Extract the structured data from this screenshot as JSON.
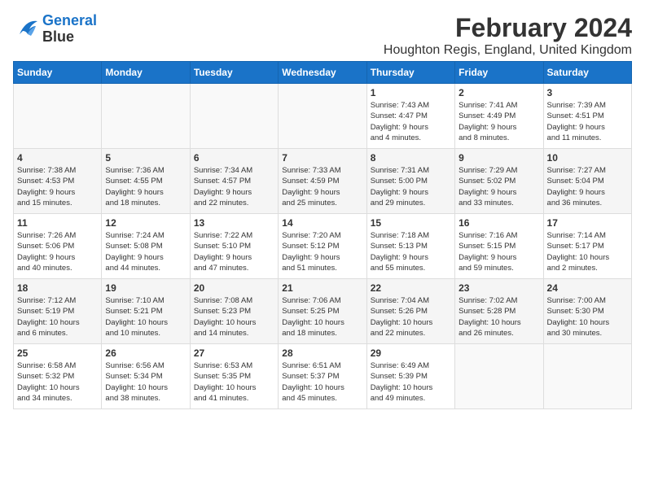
{
  "header": {
    "logo_line1": "General",
    "logo_line2": "Blue",
    "title": "February 2024",
    "subtitle": "Houghton Regis, England, United Kingdom"
  },
  "weekdays": [
    "Sunday",
    "Monday",
    "Tuesday",
    "Wednesday",
    "Thursday",
    "Friday",
    "Saturday"
  ],
  "weeks": [
    [
      {
        "day": "",
        "info": ""
      },
      {
        "day": "",
        "info": ""
      },
      {
        "day": "",
        "info": ""
      },
      {
        "day": "",
        "info": ""
      },
      {
        "day": "1",
        "info": "Sunrise: 7:43 AM\nSunset: 4:47 PM\nDaylight: 9 hours\nand 4 minutes."
      },
      {
        "day": "2",
        "info": "Sunrise: 7:41 AM\nSunset: 4:49 PM\nDaylight: 9 hours\nand 8 minutes."
      },
      {
        "day": "3",
        "info": "Sunrise: 7:39 AM\nSunset: 4:51 PM\nDaylight: 9 hours\nand 11 minutes."
      }
    ],
    [
      {
        "day": "4",
        "info": "Sunrise: 7:38 AM\nSunset: 4:53 PM\nDaylight: 9 hours\nand 15 minutes."
      },
      {
        "day": "5",
        "info": "Sunrise: 7:36 AM\nSunset: 4:55 PM\nDaylight: 9 hours\nand 18 minutes."
      },
      {
        "day": "6",
        "info": "Sunrise: 7:34 AM\nSunset: 4:57 PM\nDaylight: 9 hours\nand 22 minutes."
      },
      {
        "day": "7",
        "info": "Sunrise: 7:33 AM\nSunset: 4:59 PM\nDaylight: 9 hours\nand 25 minutes."
      },
      {
        "day": "8",
        "info": "Sunrise: 7:31 AM\nSunset: 5:00 PM\nDaylight: 9 hours\nand 29 minutes."
      },
      {
        "day": "9",
        "info": "Sunrise: 7:29 AM\nSunset: 5:02 PM\nDaylight: 9 hours\nand 33 minutes."
      },
      {
        "day": "10",
        "info": "Sunrise: 7:27 AM\nSunset: 5:04 PM\nDaylight: 9 hours\nand 36 minutes."
      }
    ],
    [
      {
        "day": "11",
        "info": "Sunrise: 7:26 AM\nSunset: 5:06 PM\nDaylight: 9 hours\nand 40 minutes."
      },
      {
        "day": "12",
        "info": "Sunrise: 7:24 AM\nSunset: 5:08 PM\nDaylight: 9 hours\nand 44 minutes."
      },
      {
        "day": "13",
        "info": "Sunrise: 7:22 AM\nSunset: 5:10 PM\nDaylight: 9 hours\nand 47 minutes."
      },
      {
        "day": "14",
        "info": "Sunrise: 7:20 AM\nSunset: 5:12 PM\nDaylight: 9 hours\nand 51 minutes."
      },
      {
        "day": "15",
        "info": "Sunrise: 7:18 AM\nSunset: 5:13 PM\nDaylight: 9 hours\nand 55 minutes."
      },
      {
        "day": "16",
        "info": "Sunrise: 7:16 AM\nSunset: 5:15 PM\nDaylight: 9 hours\nand 59 minutes."
      },
      {
        "day": "17",
        "info": "Sunrise: 7:14 AM\nSunset: 5:17 PM\nDaylight: 10 hours\nand 2 minutes."
      }
    ],
    [
      {
        "day": "18",
        "info": "Sunrise: 7:12 AM\nSunset: 5:19 PM\nDaylight: 10 hours\nand 6 minutes."
      },
      {
        "day": "19",
        "info": "Sunrise: 7:10 AM\nSunset: 5:21 PM\nDaylight: 10 hours\nand 10 minutes."
      },
      {
        "day": "20",
        "info": "Sunrise: 7:08 AM\nSunset: 5:23 PM\nDaylight: 10 hours\nand 14 minutes."
      },
      {
        "day": "21",
        "info": "Sunrise: 7:06 AM\nSunset: 5:25 PM\nDaylight: 10 hours\nand 18 minutes."
      },
      {
        "day": "22",
        "info": "Sunrise: 7:04 AM\nSunset: 5:26 PM\nDaylight: 10 hours\nand 22 minutes."
      },
      {
        "day": "23",
        "info": "Sunrise: 7:02 AM\nSunset: 5:28 PM\nDaylight: 10 hours\nand 26 minutes."
      },
      {
        "day": "24",
        "info": "Sunrise: 7:00 AM\nSunset: 5:30 PM\nDaylight: 10 hours\nand 30 minutes."
      }
    ],
    [
      {
        "day": "25",
        "info": "Sunrise: 6:58 AM\nSunset: 5:32 PM\nDaylight: 10 hours\nand 34 minutes."
      },
      {
        "day": "26",
        "info": "Sunrise: 6:56 AM\nSunset: 5:34 PM\nDaylight: 10 hours\nand 38 minutes."
      },
      {
        "day": "27",
        "info": "Sunrise: 6:53 AM\nSunset: 5:35 PM\nDaylight: 10 hours\nand 41 minutes."
      },
      {
        "day": "28",
        "info": "Sunrise: 6:51 AM\nSunset: 5:37 PM\nDaylight: 10 hours\nand 45 minutes."
      },
      {
        "day": "29",
        "info": "Sunrise: 6:49 AM\nSunset: 5:39 PM\nDaylight: 10 hours\nand 49 minutes."
      },
      {
        "day": "",
        "info": ""
      },
      {
        "day": "",
        "info": ""
      }
    ]
  ]
}
